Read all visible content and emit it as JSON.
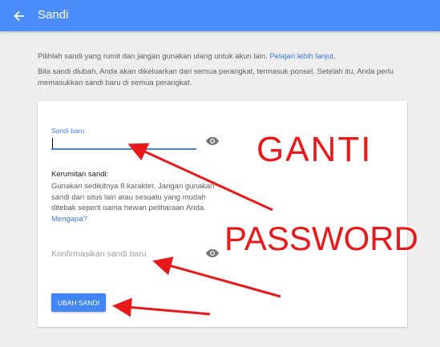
{
  "header": {
    "title": "Sandi",
    "back_icon": "arrow-back-icon"
  },
  "intro": {
    "line1": "Pilihlah sandi yang rumit dan jangan gunakan ulang untuk akun lain.",
    "learn_more": "Pelajari lebih lanjut",
    "line1_end": ".",
    "line2": "Bila sandi diubah, Anda akan dikeluarkan dari semua perangkat, termasuk ponsel. Setelah itu, Anda perlu memasukkan sandi baru di semua perangkat."
  },
  "form": {
    "new_password_label": "Sandi baru",
    "new_password_value": "",
    "strength_title": "Kerumitan sandi:",
    "strength_text": "Gunakan sedikitnya 8 karakter. Jangan gunakan sandi dari situs lain atau sesuatu yang mudah ditebak seperti nama hewan peliharaan Anda.",
    "why_link": "Mengapa?",
    "confirm_placeholder": "Konfirmasikan sandi baru",
    "submit_label": "UBAH SANDI",
    "visibility_icon": "eye-icon"
  },
  "annotations": {
    "word1": "GANTI",
    "word2": "PASSWORD",
    "color": "#e8191b"
  },
  "colors": {
    "topbar": "#4b8df8",
    "accent": "#4285f4",
    "link": "#3b78e7",
    "background": "#eeeeee"
  }
}
